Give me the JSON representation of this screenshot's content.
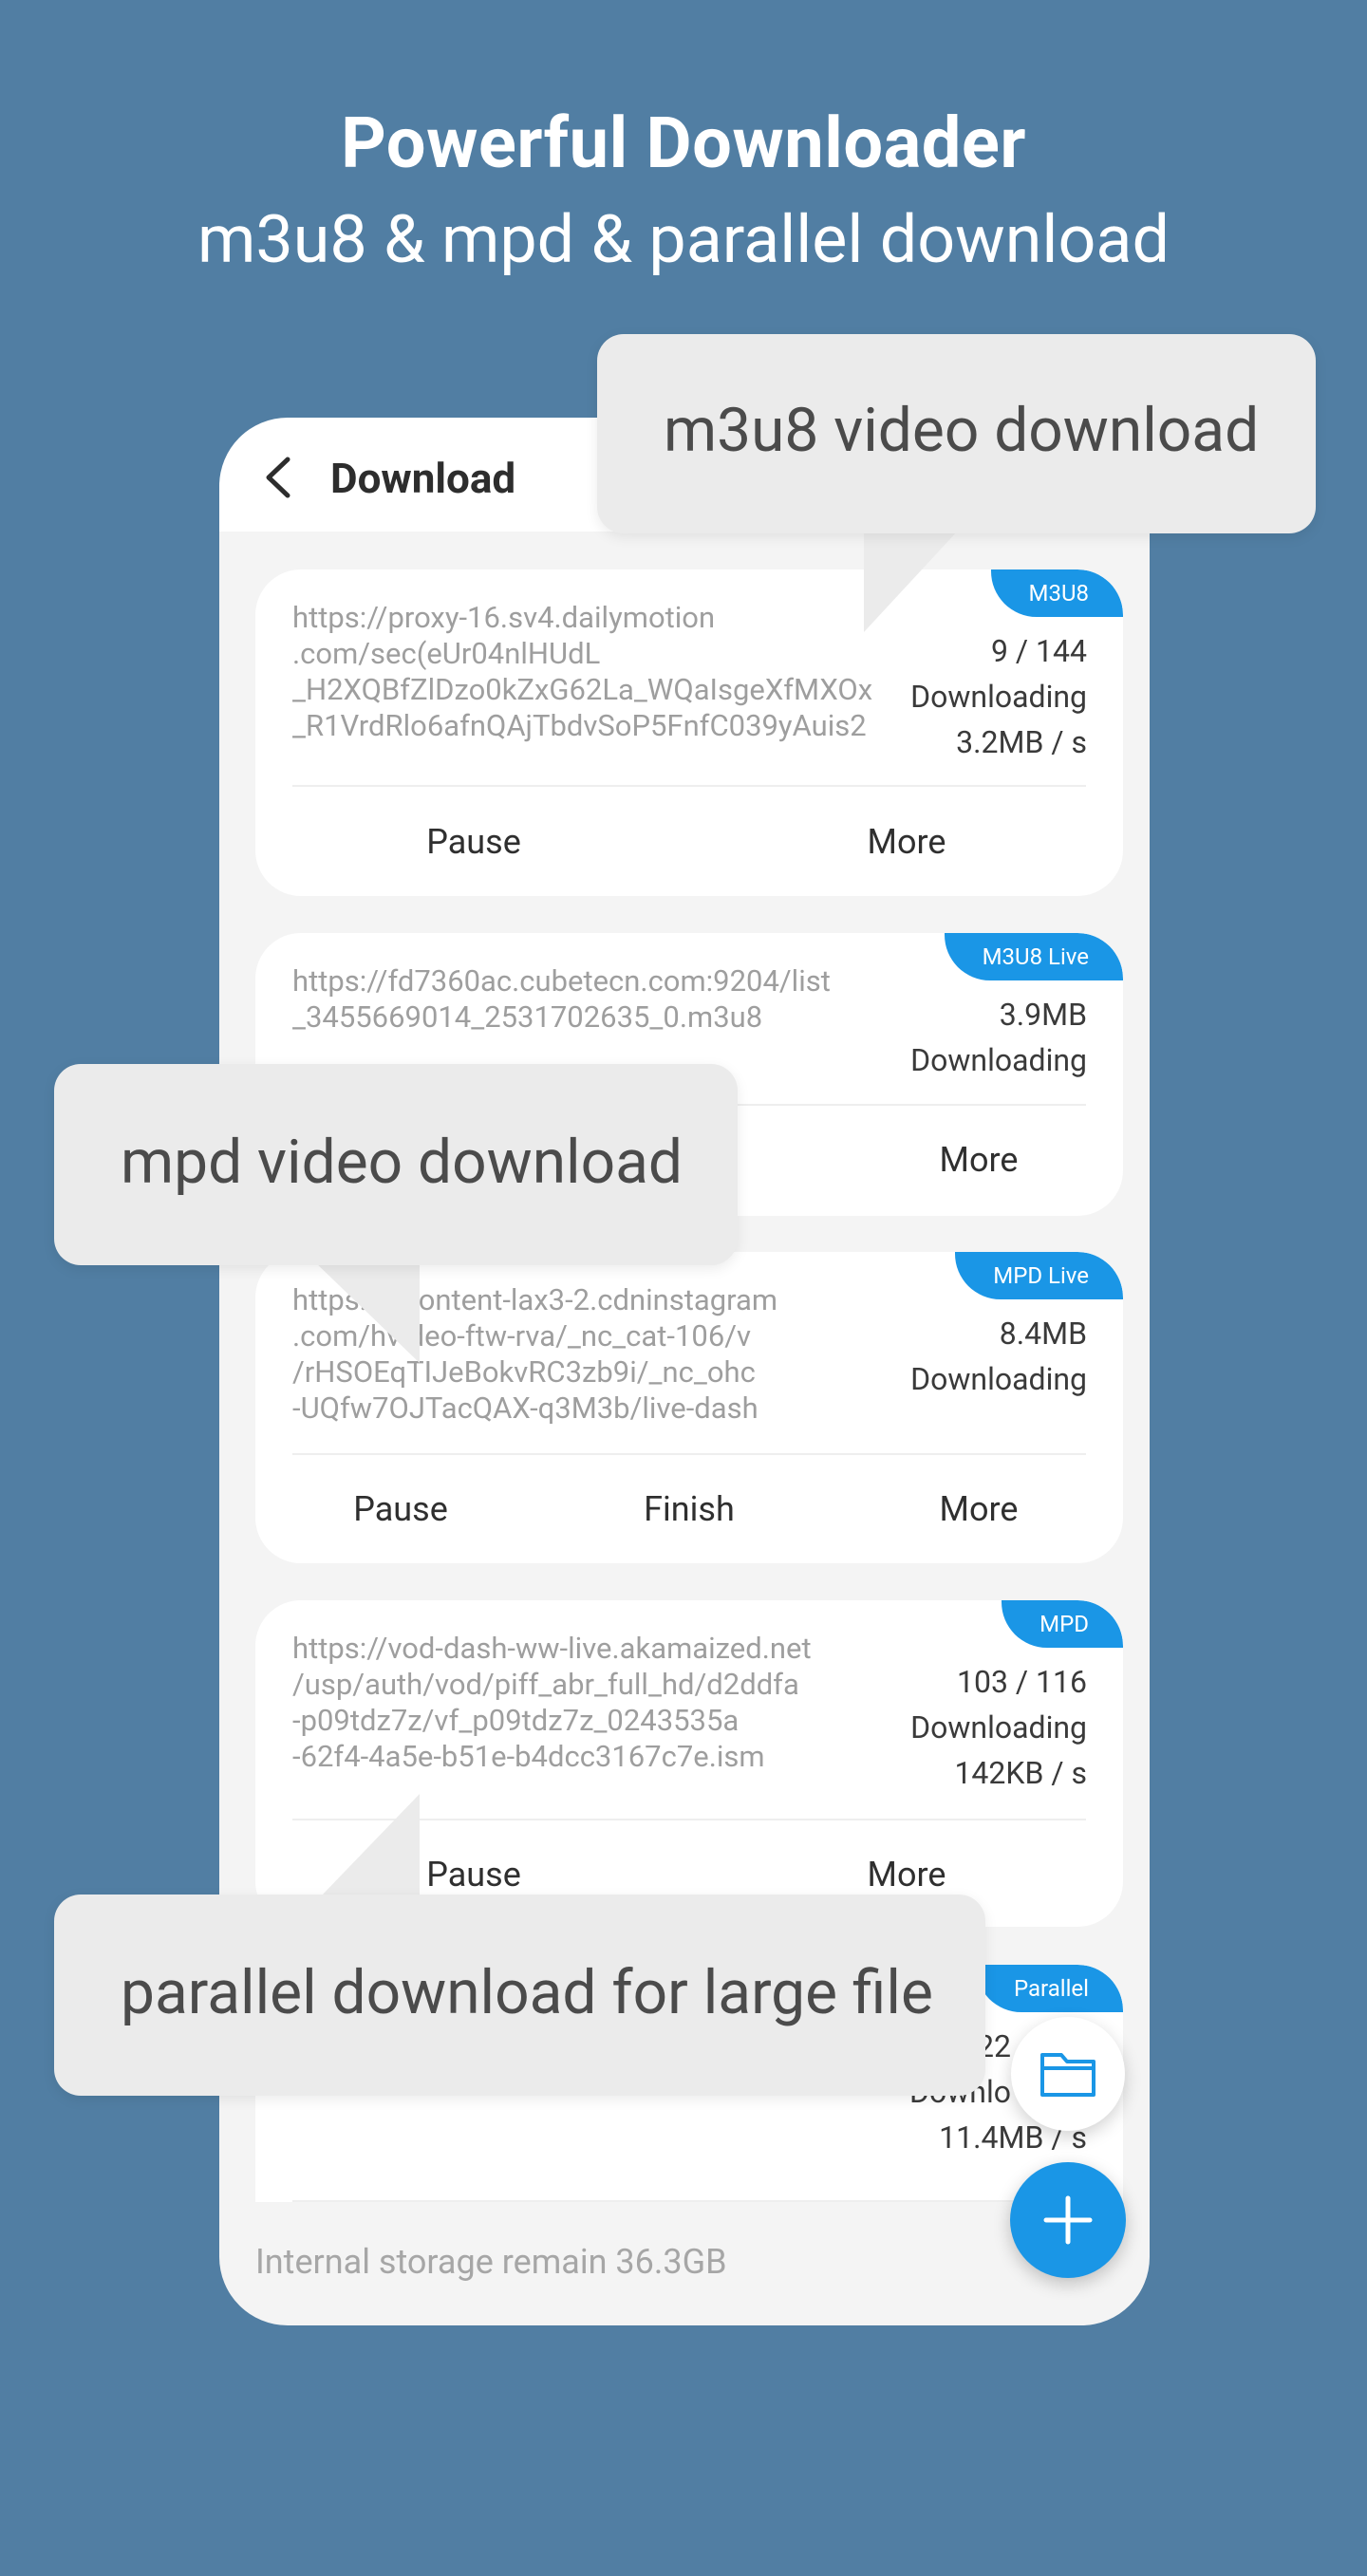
{
  "headline": {
    "title": "Powerful Downloader",
    "subtitle": "m3u8 & mpd & parallel download"
  },
  "header": {
    "title": "Download"
  },
  "callouts": {
    "m3u8": "m3u8 video download",
    "mpd": "mpd video download",
    "parallel": "parallel download for large file"
  },
  "downloads": [
    {
      "tag": "M3U8",
      "url": "https://proxy-16.sv4.dailymotion\n.com/sec(eUr04nlHUdL\n_H2XQBfZlDzo0kZxG62La_WQaIsgeXfMXOx\n_R1VrdRlo6afnQAjTbdvSoP5FnfC039yAuis2",
      "progress": "9 / 144",
      "status": "Downloading",
      "speed": "3.2MB / s",
      "actions": [
        "Pause",
        "More"
      ]
    },
    {
      "tag": "M3U8 Live",
      "url": "https://fd7360ac.cubetecn.com:9204/list\n_3455669014_2531702635_0.m3u8",
      "size": "3.9MB",
      "status": "Downloading",
      "actions": [
        "More"
      ]
    },
    {
      "tag": "MPD Live",
      "url": "https://scontent-lax3-2.cdninstagram\n.com/hvideo-ftw-rva/_nc_cat-106/v\n/rHSOEqTIJeBokvRC3zb9i/_nc_ohc\n-UQfw7OJTacQAX-q3M3b/live-dash",
      "size": "8.4MB",
      "status": "Downloading",
      "actions": [
        "Pause",
        "Finish",
        "More"
      ]
    },
    {
      "tag": "MPD",
      "url": "https://vod-dash-ww-live.akamaized.net\n/usp/auth/vod/piff_abr_full_hd/d2ddfa\n-p09tdz7z/vf_p09tdz7z_0243535a\n-62f4-4a5e-b51e-b4dcc3167c7e.ism",
      "progress": "103 / 116",
      "status": "Downloading",
      "speed": "142KB / s",
      "actions": [
        "Pause",
        "More"
      ]
    },
    {
      "tag": "Parallel",
      "progress_partial": "22",
      "status_partial": "Downlo",
      "speed": "11.4MB / s"
    }
  ],
  "footer": {
    "storage": "Internal storage remain 36.3GB"
  },
  "icons": {
    "back": "chevron-left-icon",
    "folder": "folder-icon",
    "add": "plus-icon"
  },
  "colors": {
    "background": "#517ea3",
    "accent": "#1a96e6",
    "bubble": "#ebebeb"
  }
}
